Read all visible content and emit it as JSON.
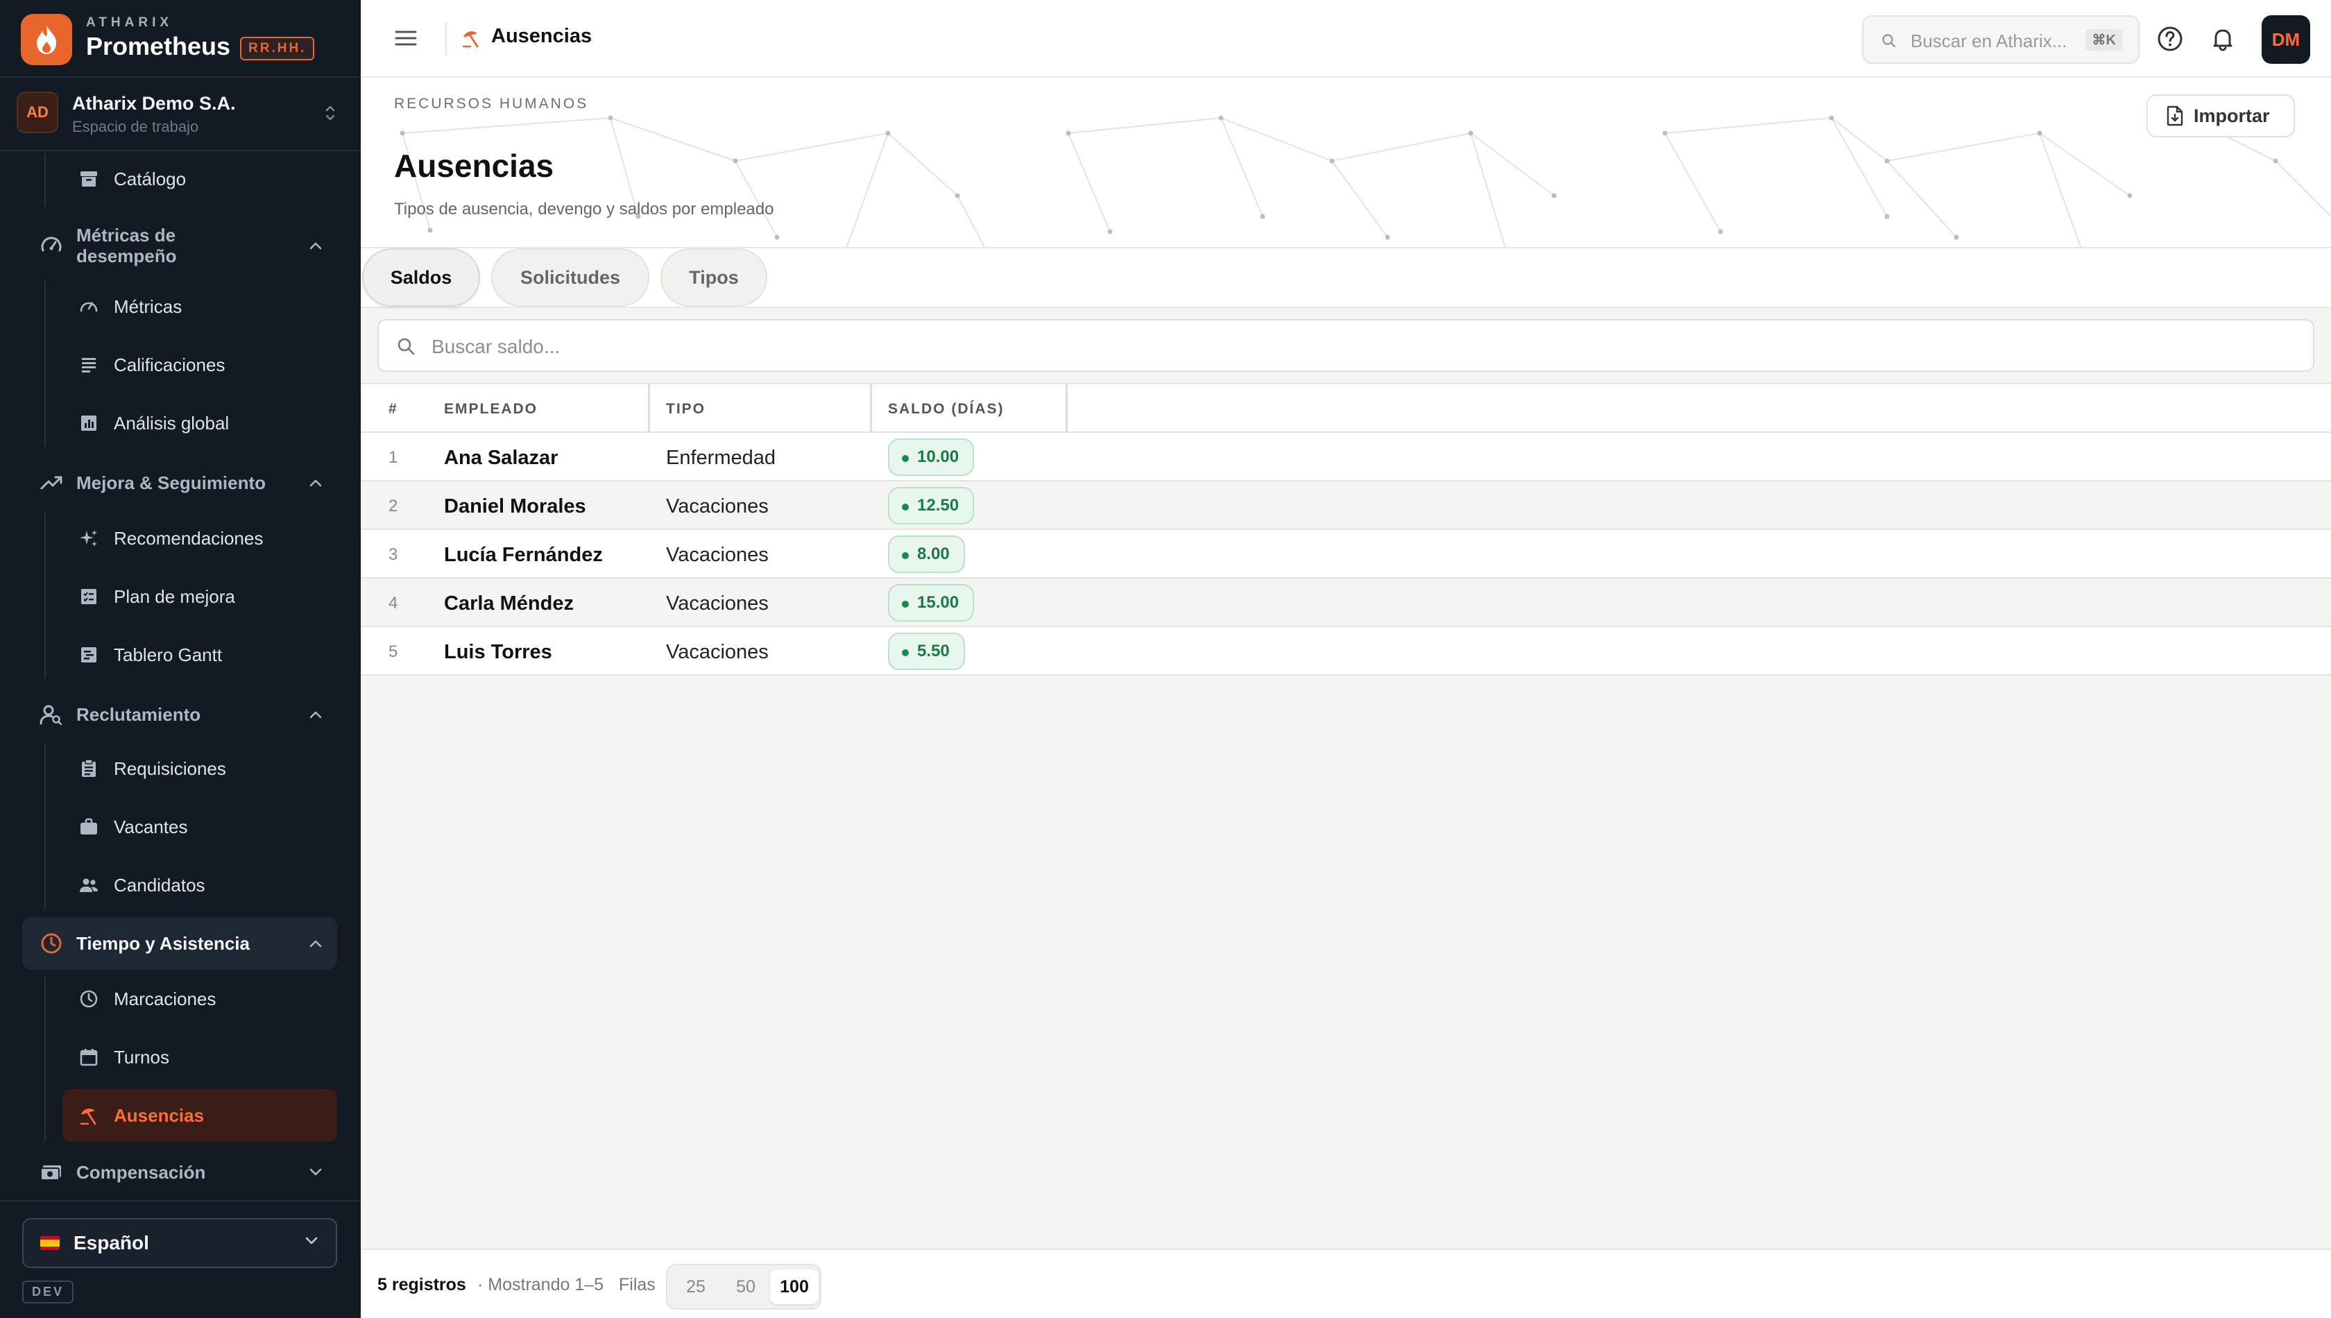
{
  "brand": {
    "eyebrow": "ATHARIX",
    "name": "Prometheus",
    "badge": "RR.HH."
  },
  "workspace": {
    "initials": "AD",
    "name": "Atharix Demo S.A.",
    "subtitle": "Espacio de trabajo"
  },
  "sidebar": {
    "catalogo": "Catálogo",
    "metricas_group": "Métricas de desempeño",
    "metricas_group_line1": "Métricas de",
    "metricas_group_line2": "desempeño",
    "metricas": "Métricas",
    "calificaciones": "Calificaciones",
    "analisis": "Análisis global",
    "mejora_group": "Mejora & Seguimiento",
    "recomendaciones": "Recomendaciones",
    "plan": "Plan de mejora",
    "gantt": "Tablero Gantt",
    "reclutamiento_group": "Reclutamiento",
    "requisiciones": "Requisiciones",
    "vacantes": "Vacantes",
    "candidatos": "Candidatos",
    "tiempo_group": "Tiempo y Asistencia",
    "marcaciones": "Marcaciones",
    "turnos": "Turnos",
    "ausencias": "Ausencias",
    "compensacion_group": "Compensación",
    "language": "Español",
    "env": "DEV"
  },
  "topbar": {
    "breadcrumb": "Ausencias",
    "search_placeholder": "Buscar en Atharix...",
    "shortcut": "⌘K",
    "user_initials": "DM"
  },
  "header": {
    "eyebrow": "RECURSOS HUMANOS",
    "title": "Ausencias",
    "subtitle": "Tipos de ausencia, devengo y saldos por empleado",
    "import_label": "Importar"
  },
  "tabs": [
    {
      "label": "Saldos",
      "active": true
    },
    {
      "label": "Solicitudes",
      "active": false
    },
    {
      "label": "Tipos",
      "active": false
    }
  ],
  "table_search": {
    "placeholder": "Buscar saldo..."
  },
  "table": {
    "headers": {
      "num": "#",
      "employee": "EMPLEADO",
      "type": "TIPO",
      "balance": "SALDO (DÍAS)"
    },
    "rows": [
      {
        "num": "1",
        "employee": "Ana Salazar",
        "type": "Enfermedad",
        "balance": "10.00"
      },
      {
        "num": "2",
        "employee": "Daniel Morales",
        "type": "Vacaciones",
        "balance": "12.50"
      },
      {
        "num": "3",
        "employee": "Lucía Fernández",
        "type": "Vacaciones",
        "balance": "8.00"
      },
      {
        "num": "4",
        "employee": "Carla Méndez",
        "type": "Vacaciones",
        "balance": "15.00"
      },
      {
        "num": "5",
        "employee": "Luis Torres",
        "type": "Vacaciones",
        "balance": "5.50"
      }
    ]
  },
  "footer": {
    "count": "5 registros",
    "showing": "· Mostrando 1–5",
    "rows_label": "Filas",
    "page_sizes": [
      "25",
      "50",
      "100"
    ],
    "active_page_size": "100"
  },
  "colors": {
    "accent": "#e8652b",
    "sidebar_bg": "#121a24",
    "success": "#1b7a43"
  }
}
